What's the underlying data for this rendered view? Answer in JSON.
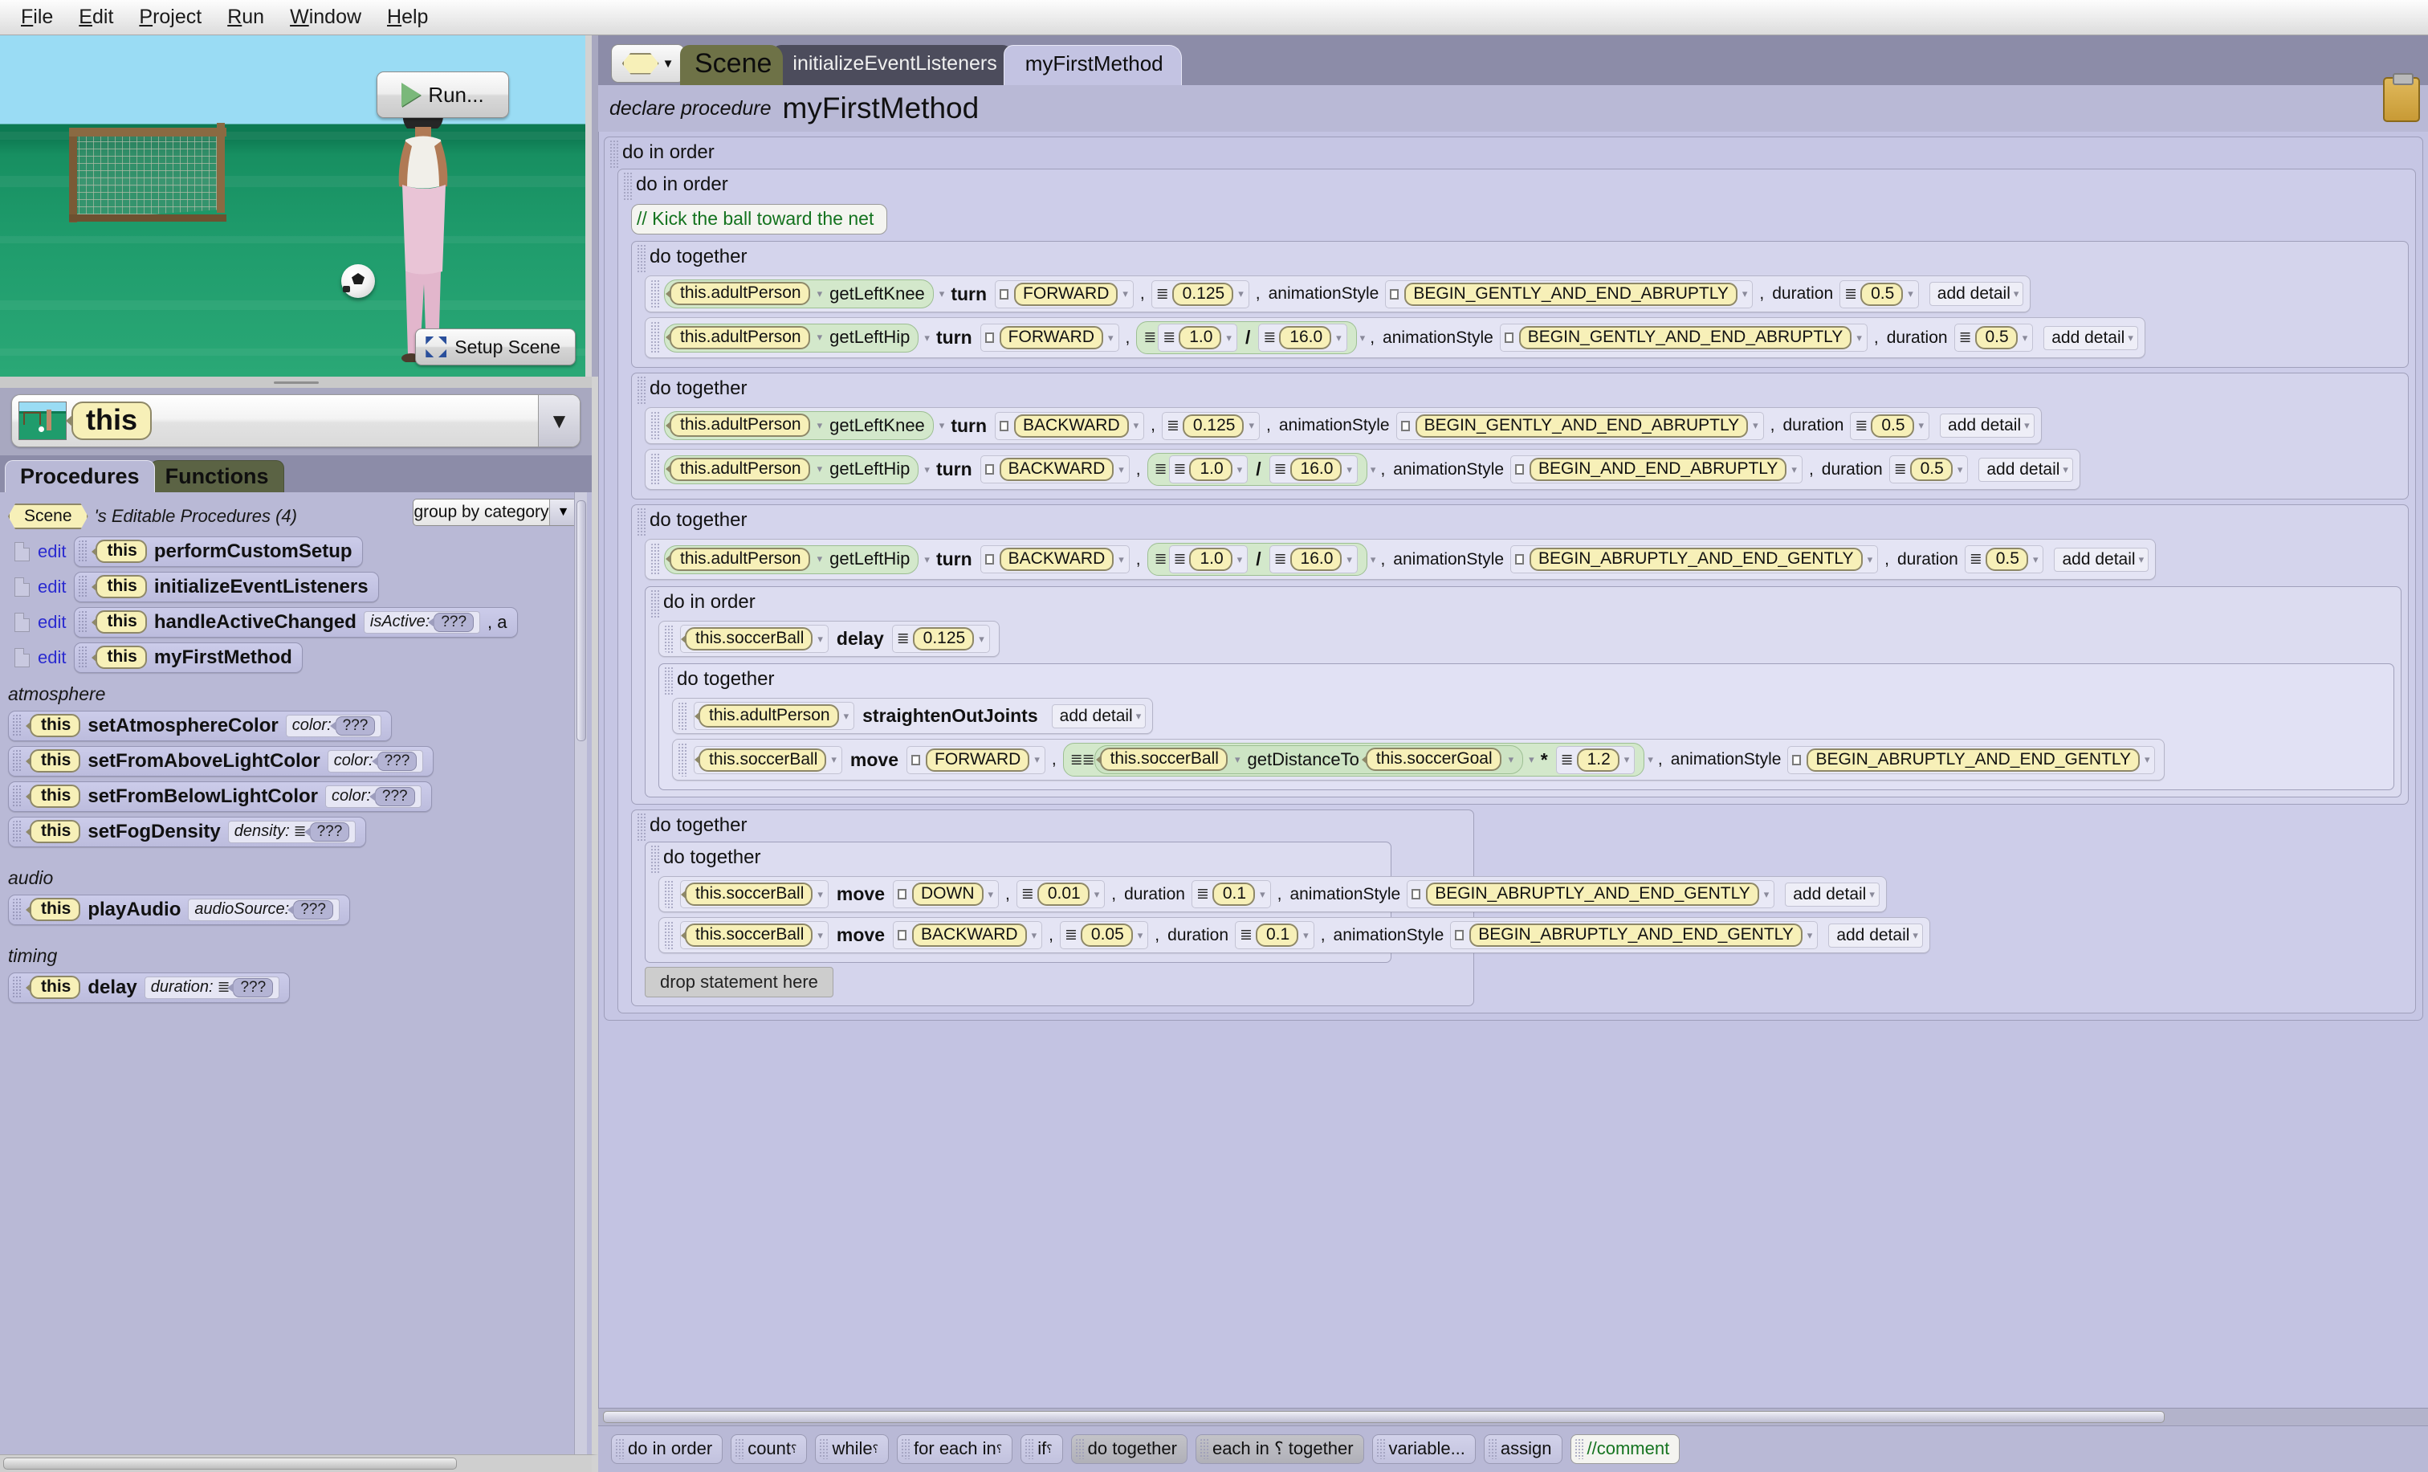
{
  "menubar": {
    "items": [
      "File",
      "Edit",
      "Project",
      "Run",
      "Window",
      "Help"
    ]
  },
  "scene_panel": {
    "run_button": "Run...",
    "run_icon": "play-triangle-icon",
    "setup_scene_button": "Setup Scene",
    "setup_scene_icon": "expand-arrows-icon"
  },
  "this_selector": {
    "value": "this",
    "caret": "▼",
    "thumbnail": "scene-thumbnail-icon"
  },
  "panel_tabs": {
    "procedures": "Procedures",
    "functions": "Functions"
  },
  "group_by": {
    "label": "group by category",
    "caret": "▼"
  },
  "editable_procedures": {
    "owner": "Scene",
    "title": "'s Editable Procedures (4)",
    "edit_label": "edit",
    "this_label": "this",
    "rows": [
      {
        "name": "performCustomSetup",
        "params": []
      },
      {
        "name": "initializeEventListeners",
        "params": []
      },
      {
        "name": "handleActiveChanged",
        "params": [
          {
            "label": "isActive:",
            "value": "???",
            "glyph": "enum"
          }
        ],
        "trailing": ", a"
      },
      {
        "name": "myFirstMethod",
        "params": []
      }
    ]
  },
  "categories": [
    {
      "name": "atmosphere",
      "rows": [
        {
          "name": "setAtmosphereColor",
          "param_label": "color:",
          "param_value": "???",
          "glyph": "color"
        },
        {
          "name": "setFromAboveLightColor",
          "param_label": "color:",
          "param_value": "???",
          "glyph": "color"
        },
        {
          "name": "setFromBelowLightColor",
          "param_label": "color:",
          "param_value": "???",
          "glyph": "color"
        },
        {
          "name": "setFogDensity",
          "param_label": "density:",
          "param_value": "???",
          "glyph": "number"
        }
      ]
    },
    {
      "name": "audio",
      "rows": [
        {
          "name": "playAudio",
          "param_label": "audioSource:",
          "param_value": "???",
          "glyph": "color"
        }
      ]
    },
    {
      "name": "timing",
      "rows": [
        {
          "name": "delay",
          "param_label": "duration:",
          "param_value": "???",
          "glyph": "number"
        }
      ]
    }
  ],
  "editor": {
    "class_chooser_icon": "yellow-hexagon-icon",
    "class_chooser_caret": "▼",
    "tabs": [
      {
        "label": "Scene",
        "state": "class"
      },
      {
        "label": "initializeEventListeners",
        "state": "inactive"
      },
      {
        "label": "myFirstMethod",
        "state": "active"
      }
    ],
    "declaration": {
      "prefix": "declare procedure",
      "name": "myFirstMethod"
    },
    "clipboard_icon": "clipboard-icon",
    "drop_zone": "drop statement here",
    "add_detail": "add detail",
    "caret": "▾",
    "labels": {
      "do_in_order": "do in order",
      "do_together": "do together",
      "animation_style": "animationStyle",
      "duration": "duration",
      "comma": ",",
      "divide": "/",
      "times": "*"
    },
    "code": {
      "comment": "// Kick the ball toward the net",
      "groups": [
        {
          "type": "do together",
          "statements": [
            {
              "target": "this.adultPerson",
              "joint": "getLeftKnee",
              "verb": "turn",
              "direction": "FORWARD",
              "amount": "0.125",
              "style": "BEGIN_GENTLY_AND_END_ABRUPTLY",
              "duration": "0.5"
            },
            {
              "target": "this.adultPerson",
              "joint": "getLeftHip",
              "verb": "turn",
              "direction": "FORWARD",
              "numerator": "1.0",
              "denominator": "16.0",
              "style": "BEGIN_GENTLY_AND_END_ABRUPTLY",
              "duration": "0.5"
            }
          ]
        },
        {
          "type": "do together",
          "statements": [
            {
              "target": "this.adultPerson",
              "joint": "getLeftKnee",
              "verb": "turn",
              "direction": "BACKWARD",
              "amount": "0.125",
              "style": "BEGIN_GENTLY_AND_END_ABRUPTLY",
              "duration": "0.5"
            },
            {
              "target": "this.adultPerson",
              "joint": "getLeftHip",
              "verb": "turn",
              "direction": "BACKWARD",
              "numerator": "1.0",
              "denominator": "16.0",
              "style": "BEGIN_AND_END_ABRUPTLY",
              "duration": "0.5"
            }
          ]
        },
        {
          "type": "do together",
          "statements": [
            {
              "target": "this.adultPerson",
              "joint": "getLeftHip",
              "verb": "turn",
              "direction": "BACKWARD",
              "numerator": "1.0",
              "denominator": "16.0",
              "style": "BEGIN_ABRUPTLY_AND_END_GENTLY",
              "duration": "0.5"
            }
          ],
          "nested": {
            "type": "do in order",
            "delay": {
              "target": "this.soccerBall",
              "verb": "delay",
              "amount": "0.125"
            },
            "inner": {
              "type": "do together",
              "straighten": {
                "target": "this.adultPerson",
                "verb": "straightenOutJoints"
              },
              "move": {
                "target": "this.soccerBall",
                "verb": "move",
                "direction": "FORWARD",
                "expr_object": "this.soccerBall",
                "expr_func": "getDistanceTo",
                "expr_arg": "this.soccerGoal",
                "multiplier": "1.2",
                "style": "BEGIN_ABRUPTLY_AND_END_GENTLY"
              }
            }
          }
        },
        {
          "type": "do together",
          "nested_together": {
            "type": "do together",
            "statements": [
              {
                "target": "this.soccerBall",
                "verb": "move",
                "direction": "DOWN",
                "amount": "0.01",
                "duration": "0.1",
                "style": "BEGIN_ABRUPTLY_AND_END_GENTLY"
              },
              {
                "target": "this.soccerBall",
                "verb": "move",
                "direction": "BACKWARD",
                "amount": "0.05",
                "duration": "0.1",
                "style": "BEGIN_ABRUPTLY_AND_END_GENTLY"
              }
            ]
          }
        }
      ]
    }
  },
  "palette": [
    {
      "label": "do in order",
      "style": "normal",
      "sub": ""
    },
    {
      "label": "count",
      "style": "normal",
      "sub": "⸮"
    },
    {
      "label": "while",
      "style": "normal",
      "sub": "⸮"
    },
    {
      "label": "for each in",
      "style": "normal",
      "sub": "⸮"
    },
    {
      "label": "if",
      "style": "normal",
      "sub": "⸮"
    },
    {
      "label": "do together",
      "style": "strong",
      "sub": ""
    },
    {
      "label": "each in ⸮ together",
      "style": "strong",
      "sub": ""
    },
    {
      "label": "variable...",
      "style": "normal",
      "sub": ""
    },
    {
      "label": "assign",
      "style": "normal",
      "sub": ""
    },
    {
      "label": "//comment",
      "style": "comment",
      "sub": ""
    }
  ]
}
